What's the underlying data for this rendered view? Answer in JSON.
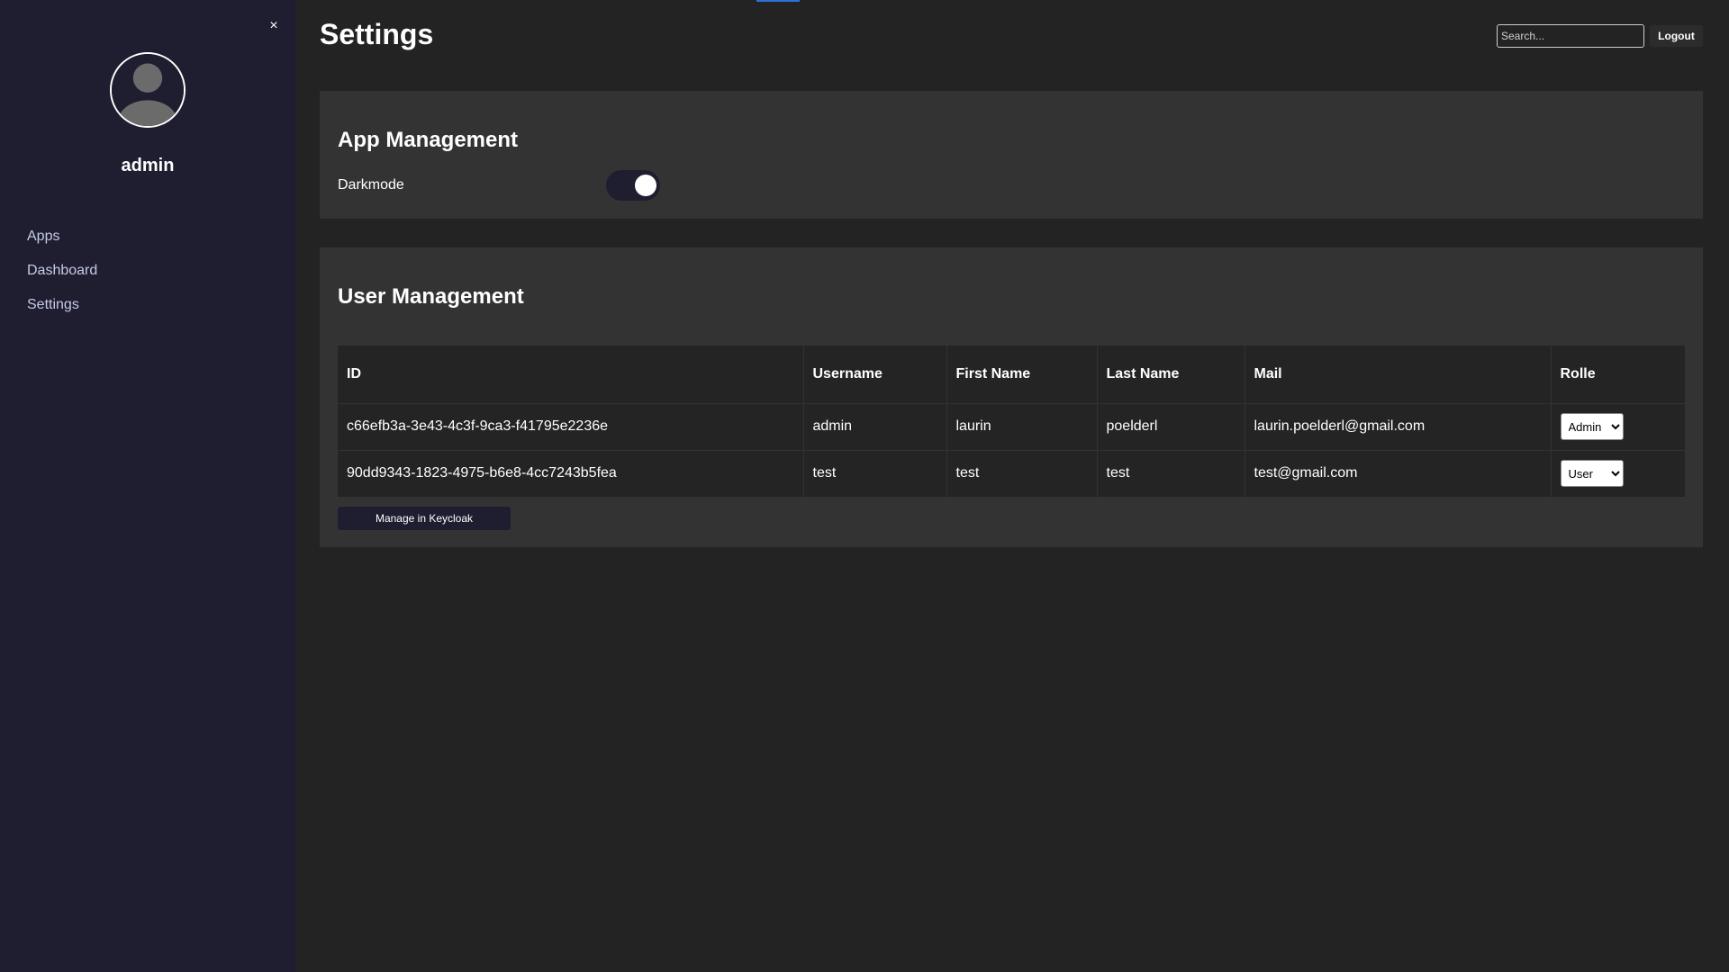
{
  "sidebar": {
    "close_glyph": "×",
    "avatar_icon": "user-avatar-icon",
    "username": "admin",
    "items": [
      {
        "label": "Apps"
      },
      {
        "label": "Dashboard"
      },
      {
        "label": "Settings"
      }
    ]
  },
  "header": {
    "title": "Settings",
    "search_placeholder": "Search...",
    "logout_label": "Logout"
  },
  "app_management": {
    "title": "App Management",
    "darkmode_label": "Darkmode",
    "darkmode_on": true
  },
  "user_management": {
    "title": "User Management",
    "columns": [
      "ID",
      "Username",
      "First Name",
      "Last Name",
      "Mail",
      "Rolle"
    ],
    "rows": [
      {
        "id": "c66efb3a-3e43-4c3f-9ca3-f41795e2236e",
        "username": "admin",
        "first_name": "laurin",
        "last_name": "poelderl",
        "mail": "laurin.poelderl@gmail.com",
        "role": "Admin"
      },
      {
        "id": "90dd9343-1823-4975-b6e8-4cc7243b5fea",
        "username": "test",
        "first_name": "test",
        "last_name": "test",
        "mail": "test@gmail.com",
        "role": "User"
      }
    ],
    "manage_button_label": "Manage in Keycloak"
  },
  "colors": {
    "sidebar_bg": "#1e1e30",
    "page_bg": "#232323",
    "panel_bg": "#333333",
    "accent": "#2f6fd6"
  }
}
